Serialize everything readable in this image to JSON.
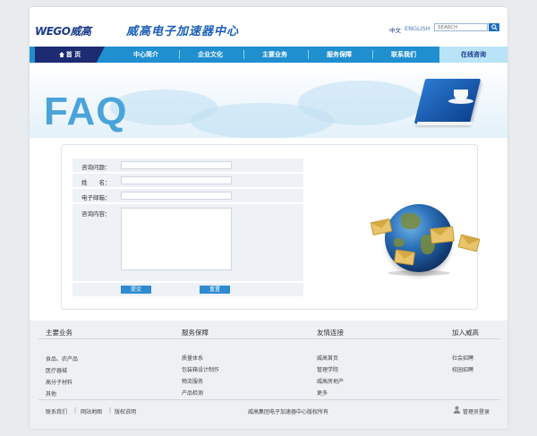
{
  "header": {
    "logo": "WEGO威高",
    "site_title": "威高电子加速器中心",
    "lang_cn": "中文",
    "lang_en": "ENGLISH",
    "search_placeholder": "SEARCH",
    "search_icon": "search-icon"
  },
  "nav": {
    "home": "首 页",
    "items": [
      "中心简介",
      "企业文化",
      "主要业务",
      "服务保障",
      "联系我们"
    ],
    "online": "在线咨询"
  },
  "banner": {
    "title": "FAQ"
  },
  "form": {
    "question_label": "咨询问题：",
    "name_label": "姓　　名：",
    "email_label": "电子邮箱：",
    "content_label": "咨询内容：",
    "submit_label": "提交",
    "reset_label": "重置"
  },
  "footer": {
    "columns": [
      {
        "heading": "主要业务",
        "links": [
          "食品、农产品",
          "医疗器械",
          "高分子材料",
          "其他"
        ]
      },
      {
        "heading": "服务保障",
        "links": [
          "质量体系",
          "包装箱设计制作",
          "物流服务",
          "产品检测"
        ]
      },
      {
        "heading": "友情连接",
        "links": [
          "威高首页",
          "管理学院",
          "威高房地产",
          "更多"
        ]
      },
      {
        "heading": "加入威高",
        "links": [
          "社会招聘",
          "校园招聘"
        ]
      }
    ],
    "bottom_links": [
      "联系我们",
      "网站地图",
      "版权说明"
    ],
    "separator": "|",
    "copyright": "威高集团电子加速器中心版权所有",
    "admin_login": "管理员登录"
  },
  "colors": {
    "nav_blue": "#1f8fd0",
    "home_navy": "#1c2b72",
    "online_light": "#b9e3f7",
    "faq_blue": "#4aa4d9"
  }
}
